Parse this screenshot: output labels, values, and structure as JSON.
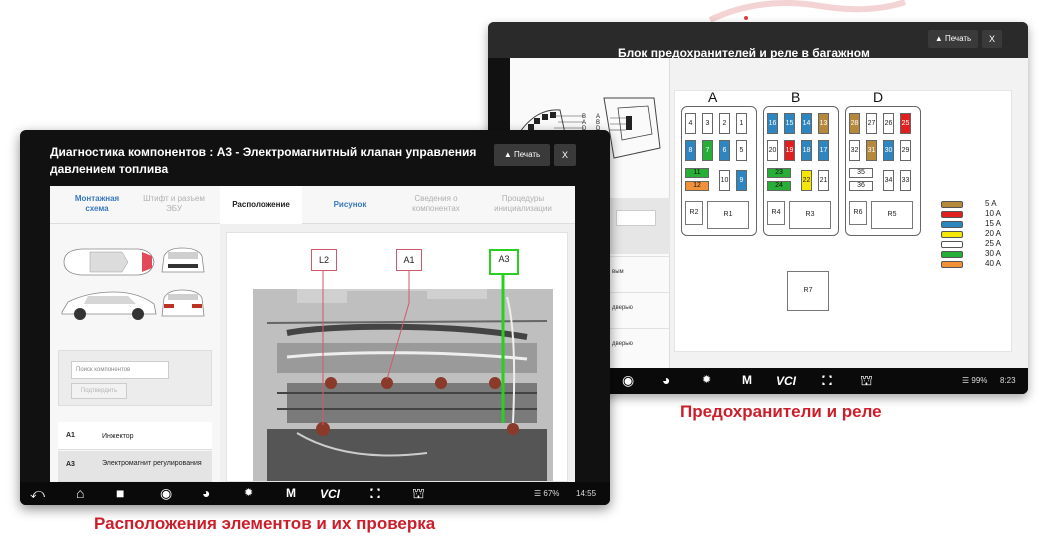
{
  "fuse_screen": {
    "title": "Блок предохранителей и реле в багажном",
    "print_label": "Печать",
    "close_label": "X",
    "left_items": [
      "вым",
      "дверью",
      "дверью"
    ],
    "groups": [
      {
        "label": "A",
        "top": [
          "4",
          "3",
          "2",
          "1"
        ],
        "mid": [
          "8",
          "7",
          "6",
          "5"
        ],
        "mini": [
          "11",
          "12"
        ],
        "side": [
          "10"
        ],
        "relays": [
          "R2",
          "R1"
        ]
      },
      {
        "label": "B",
        "top": [
          "16",
          "15",
          "14",
          "13"
        ],
        "mid": [
          "20",
          "19",
          "18",
          "17"
        ],
        "mini": [
          "23",
          "24"
        ],
        "side": [
          "22",
          "21"
        ],
        "relays": [
          "R4",
          "R3"
        ]
      },
      {
        "label": "D",
        "top": [
          "28",
          "27",
          "26",
          "25"
        ],
        "mid": [
          "32",
          "31",
          "30",
          "29"
        ],
        "mini": [
          "35",
          "36"
        ],
        "side": [
          "34",
          "33"
        ],
        "relays": [
          "R6",
          "R5"
        ]
      }
    ],
    "relay_center": "R7",
    "connector_letters": [
      "B",
      "A",
      "D",
      "A",
      "B",
      "D"
    ],
    "legend": [
      {
        "color": "#b5893c",
        "label": "5 A"
      },
      {
        "color": "#e02020",
        "label": "10 A"
      },
      {
        "color": "#2e86c1",
        "label": "15 A"
      },
      {
        "color": "#f5e60a",
        "label": "20 A"
      },
      {
        "color": "#ffffff",
        "label": "25 A"
      },
      {
        "color": "#27ae36",
        "label": "30 A"
      },
      {
        "color": "#f0913a",
        "label": "40 A"
      }
    ],
    "status_right": "99%",
    "clock": "8:23",
    "caption": "Предохранители  и  реле"
  },
  "diag_screen": {
    "title": "Диагностика компонентов : A3 - Электромагнитный клапан управления давлением топлива",
    "print_label": "Печать",
    "close_label": "X",
    "tabs": [
      {
        "label": "Монтажная схема",
        "state": "blue"
      },
      {
        "label": "Штифт и разъем ЭБУ",
        "state": "dim"
      },
      {
        "label": "Расположение",
        "state": "active"
      },
      {
        "label": "Рисунок",
        "state": "blue"
      },
      {
        "label": "Сведения о компонентах",
        "state": "dim"
      },
      {
        "label": "Процедуры инициализации",
        "state": "dim"
      }
    ],
    "search_placeholder": "Поиск компонентов",
    "search_button": "Подтвердить",
    "components": [
      {
        "code": "A1",
        "name": "Инжектор"
      },
      {
        "code": "A3",
        "name": "Электромагнит регулирования"
      }
    ],
    "callouts": [
      "L2",
      "A1",
      "A3"
    ],
    "status_right": "67%",
    "clock": "14:55",
    "nav_vci": "VCI",
    "caption": "Расположения  элементов и их проверка"
  }
}
